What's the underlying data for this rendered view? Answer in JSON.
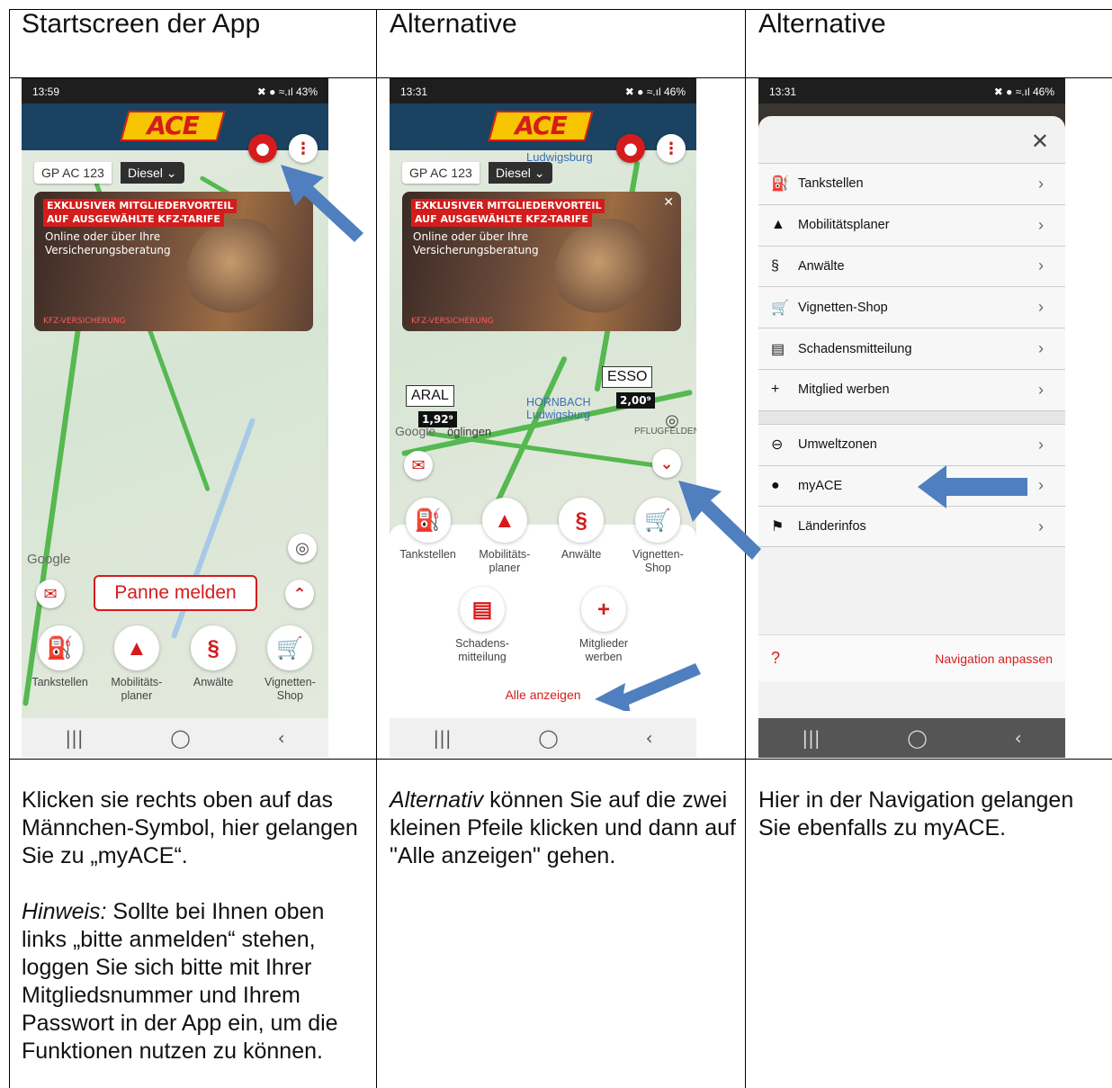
{
  "headers": [
    "Startscreen der App",
    "Alternative",
    "Alternative"
  ],
  "columns": [
    {
      "paragraphs": [
        {
          "italic": "",
          "text": "Klicken sie rechts oben auf das Männchen-Symbol, hier gelangen Sie zu „myACE“."
        },
        {
          "italic": "Hinweis:",
          "text": " Sollte bei Ihnen oben links „bitte anmelden“ stehen, loggen Sie sich bitte mit Ihrer Mitgliedsnummer und Ihrem Passwort in der App ein, um die Funktionen nutzen zu können."
        }
      ]
    },
    {
      "paragraphs": [
        {
          "italic": "Alternativ",
          "text": " können Sie auf die zwei kleinen Pfeile klicken und dann auf \"Alle anzeigen\" gehen."
        }
      ]
    },
    {
      "paragraphs": [
        {
          "italic": "",
          "text": "Hier in der Navigation gelangen Sie ebenfalls zu myACE."
        }
      ]
    }
  ],
  "phone1": {
    "time": "13:59",
    "status_right": "✖ ● ≈.ıl 43%",
    "logo": "ACE",
    "plate": "GP AC 123",
    "fuel": "Diesel",
    "banner_line1": "EXKLUSIVER MITGLIEDERVORTEIL",
    "banner_line2": "AUF AUSGEWÄHLTE KFZ-TARIFE",
    "banner_sub": "Online oder über Ihre Versicherungsberatung",
    "banner_small": "KFZ-VERSICHERUNG",
    "google": "Google",
    "panne": "Panne melden",
    "nav": [
      "Tankstellen",
      "Mobilitäts-planer",
      "Anwälte",
      "Vignetten-Shop"
    ]
  },
  "phone2": {
    "time": "13:31",
    "status_right": "✖ ● ≈.ıl 46%",
    "logo": "ACE",
    "plate": "GP AC 123",
    "fuel": "Diesel",
    "map_city": "Ludwigsburg",
    "banner_line1": "EXKLUSIVER MITGLIEDERVORTEIL",
    "banner_line2": "AUF AUSGEWÄHLTE KFZ-TARIFE",
    "banner_sub": "Online oder über Ihre Versicherungsberatung",
    "banner_small": "KFZ-VERSICHERUNG",
    "aral": "ARAL",
    "aral_price": "1,92⁹",
    "esso": "ESSO",
    "esso_price": "2,00⁹",
    "hornbach": "HORNBACH Ludwigsburg",
    "oglingen": "öglingen",
    "pflu": "PFLUGFELDEN",
    "google": "Google",
    "nav_row1": [
      "Tankstellen",
      "Mobilitäts-planer",
      "Anwälte",
      "Vignetten-Shop"
    ],
    "nav_row2": [
      "Schadens-mitteilung",
      "Mitglieder werben"
    ],
    "alle": "Alle anzeigen"
  },
  "phone3": {
    "time": "13:31",
    "status_right": "✖ ● ≈.ıl 46%",
    "menu": [
      {
        "icon": "⛽",
        "label": "Tankstellen"
      },
      {
        "icon": "▲",
        "label": "Mobilitätsplaner"
      },
      {
        "icon": "§",
        "label": "Anwälte"
      },
      {
        "icon": "🛒",
        "label": "Vignetten-Shop"
      },
      {
        "icon": "▤",
        "label": "Schadensmitteilung"
      },
      {
        "icon": "+",
        "label": "Mitglied werben"
      }
    ],
    "menu2": [
      {
        "icon": "⊖",
        "label": "Umweltzonen"
      },
      {
        "icon": "●",
        "label": "myACE"
      },
      {
        "icon": "⚑",
        "label": "Länderinfos"
      }
    ],
    "footer": "Navigation anpassen"
  },
  "colors": {
    "accent": "#d51c1c",
    "arrow": "#4f7fbf",
    "navy": "#1b4260"
  }
}
